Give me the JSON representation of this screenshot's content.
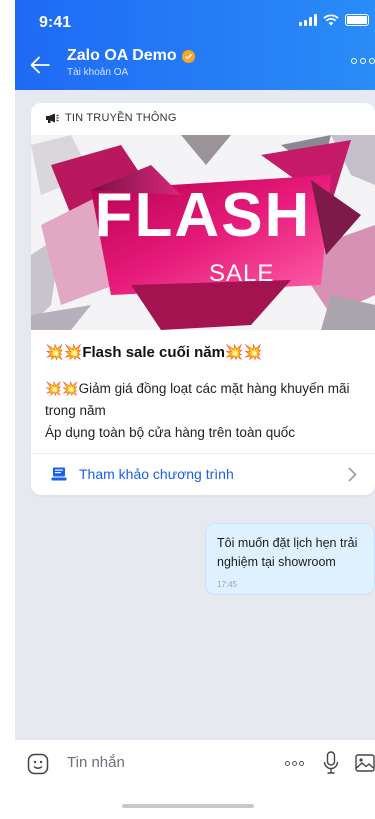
{
  "status_bar": {
    "time": "9:41"
  },
  "header": {
    "title": "Zalo OA Demo",
    "subtitle": "Tài khoản OA",
    "accent": "#1f6af5"
  },
  "card": {
    "category": "TIN TRUYỀN THÔNG",
    "banner": {
      "headline": "FLASH",
      "subline": "SALE"
    },
    "title": "💥💥Flash sale cuối năm💥💥",
    "body_lines": [
      "💥💥Giảm giá đồng loạt các mặt hàng khuyến mãi",
      "trong năm",
      "Áp dụng toàn bộ cửa hàng trên toàn quốc"
    ],
    "link_label": "Tham khảo chương trình",
    "link_color": "#1a5ef0"
  },
  "message": {
    "text": "Tôi muốn đặt lịch hẹn trải nghiệm tại showroom",
    "time": "17:45"
  },
  "composer": {
    "placeholder": "Tin nhắn"
  },
  "icons": {
    "back": "arrow-left-icon",
    "verified": "verified-badge-icon",
    "more": "more-dots-icon",
    "megaphone": "megaphone-icon",
    "link": "document-icon",
    "chevron": "chevron-right-icon",
    "emoji": "emoji-icon",
    "mic": "microphone-icon",
    "image": "image-icon"
  }
}
